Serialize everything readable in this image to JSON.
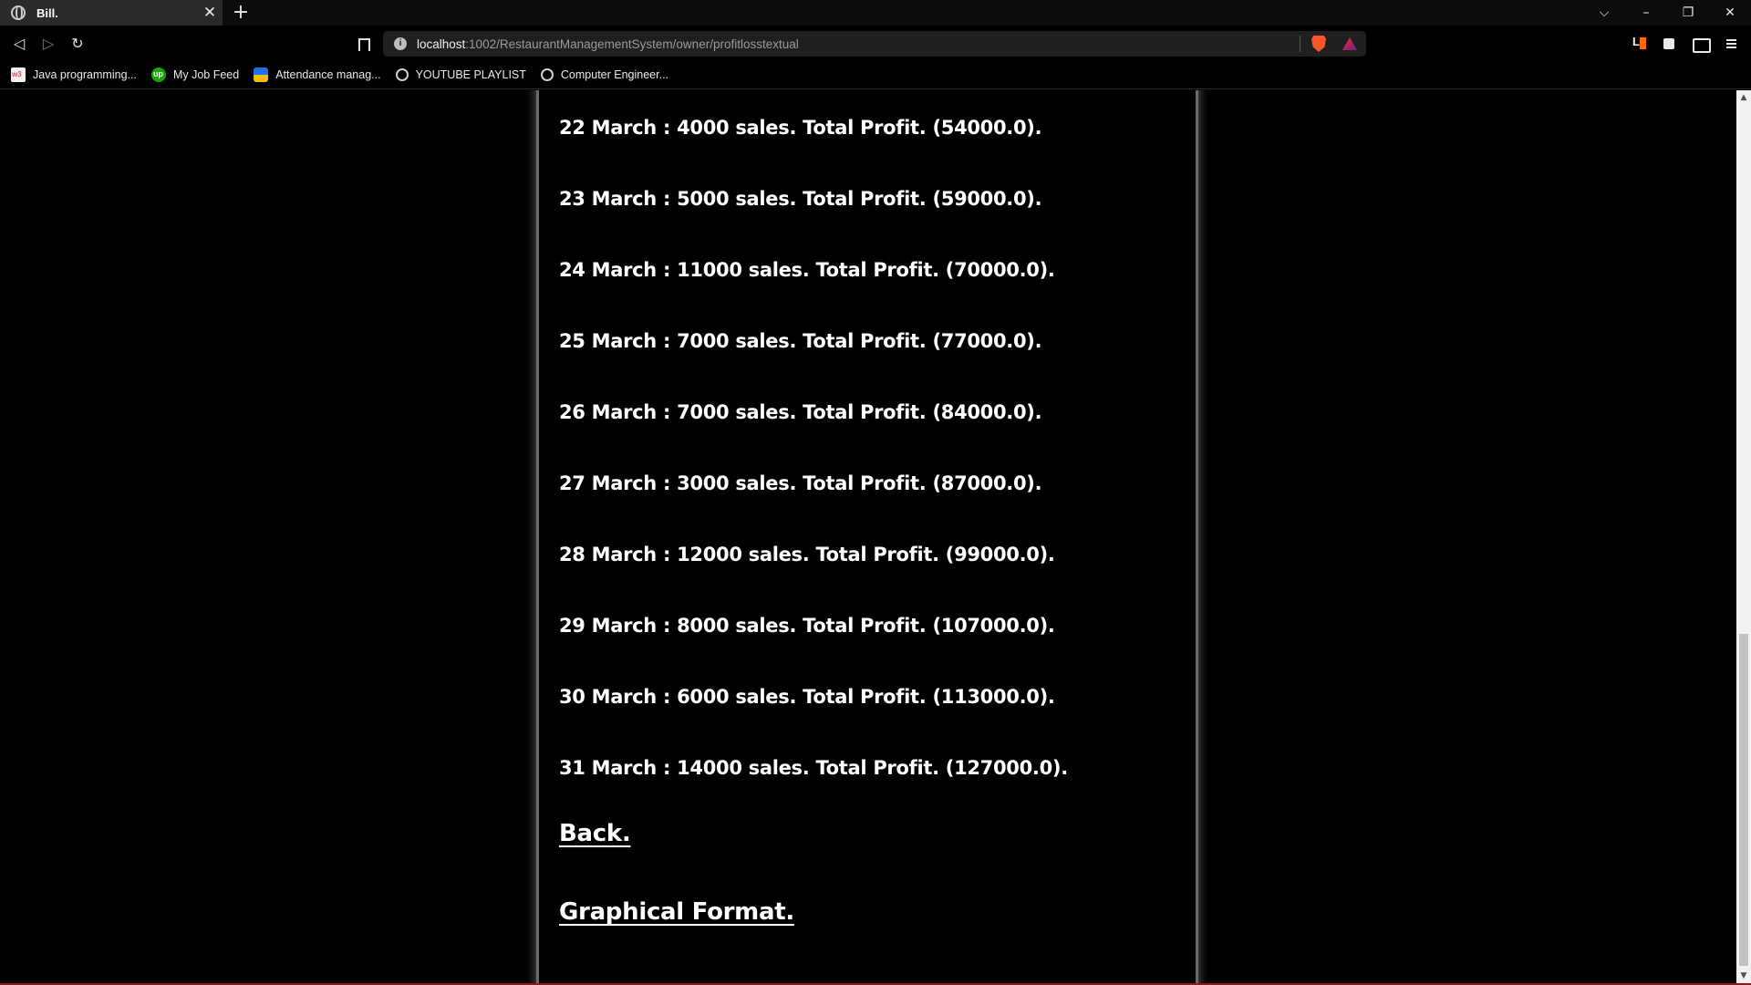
{
  "browser": {
    "tab_title": "Bill.",
    "tab_close": "✕",
    "new_tab": "+",
    "window_controls": {
      "list": "⌵",
      "minimize": "–",
      "restore": "❐",
      "close": "✕"
    },
    "nav": {
      "back": "◁",
      "forward": "▷",
      "reload": "↻"
    },
    "url_host": "localhost",
    "url_path": ":1002/RestaurantManagementSystem/owner/profitlosstextual",
    "info_icon": "i",
    "bookmarks": [
      {
        "label": "Java programming...",
        "icon": "w3schools-icon"
      },
      {
        "label": "My Job Feed",
        "icon": "upwork-icon"
      },
      {
        "label": "Attendance manag...",
        "icon": "attendance-icon"
      },
      {
        "label": "YOUTUBE PLAYLIST",
        "icon": "globe-icon"
      },
      {
        "label": "Computer Engineer...",
        "icon": "globe-icon"
      }
    ]
  },
  "page": {
    "entries": [
      "22 March : 4000 sales. Total Profit. (54000.0).",
      "23 March : 5000 sales. Total Profit. (59000.0).",
      "24 March : 11000 sales. Total Profit. (70000.0).",
      "25 March : 7000 sales. Total Profit. (77000.0).",
      "26 March : 7000 sales. Total Profit. (84000.0).",
      "27 March : 3000 sales. Total Profit. (87000.0).",
      "28 March : 12000 sales. Total Profit. (99000.0).",
      "29 March : 8000 sales. Total Profit. (107000.0).",
      "30 March : 6000 sales. Total Profit. (113000.0).",
      "31 March : 14000 sales. Total Profit. (127000.0)."
    ],
    "back_link": "Back.",
    "graphical_link": "Graphical Format."
  },
  "scrollbar": {
    "up": "▲",
    "down": "▼",
    "position_fraction": 0.63
  },
  "colors": {
    "background": "#000000",
    "text": "#ffffff",
    "panel_border": "#6b6b6b",
    "brave_orange": "#fb542b"
  }
}
